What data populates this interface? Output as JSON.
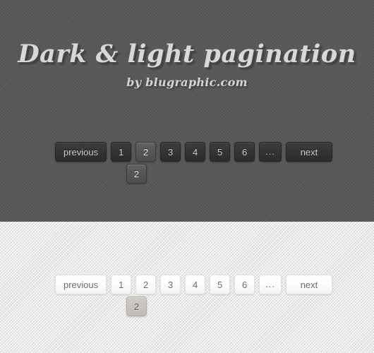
{
  "header": {
    "title": "Dark & light pagination",
    "subtitle": "by blugraphic.com"
  },
  "colors": {
    "dark_background": "#5a5a5a",
    "light_background": "#f2f2f2",
    "dark_button": "#343434",
    "dark_button_active": "#565656",
    "light_button": "#fbfbfb",
    "light_button_active": "#c8c3bf",
    "dark_text": "#cfcfcf",
    "light_text": "#6d6d6d",
    "title_text": "#d8d8d8"
  },
  "pagination_dark": {
    "theme_label": "dark",
    "previous_label": "previous",
    "next_label": "next",
    "ellipsis_label": "...",
    "pages": [
      "1",
      "2",
      "3",
      "4",
      "5",
      "6"
    ],
    "active_page": "2",
    "detached_active_label": "2"
  },
  "pagination_light": {
    "theme_label": "light",
    "previous_label": "previous",
    "next_label": "next",
    "ellipsis_label": "...",
    "pages": [
      "1",
      "2",
      "3",
      "4",
      "5",
      "6"
    ],
    "active_page": "2",
    "detached_active_label": "2"
  }
}
